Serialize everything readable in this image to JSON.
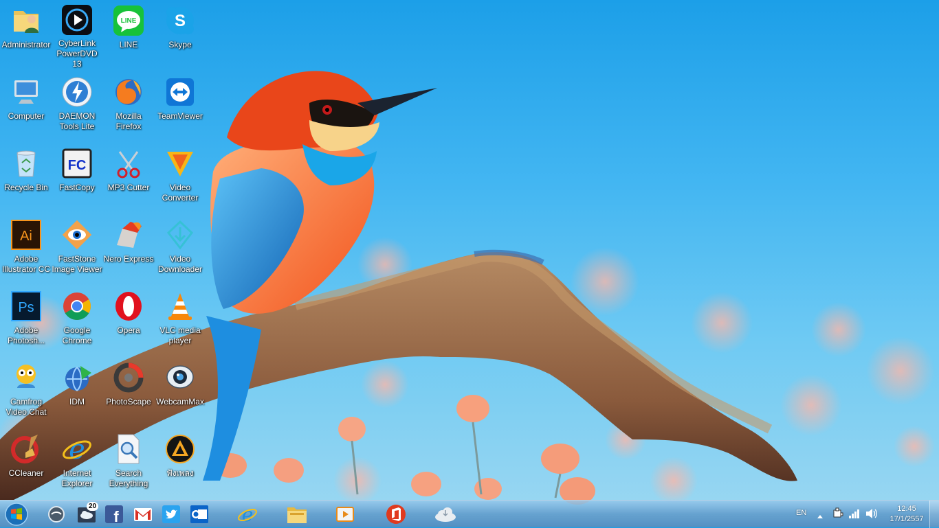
{
  "desktop": {
    "icons": [
      {
        "label": "Administrator",
        "icon": "user-folder-icon"
      },
      {
        "label": "CyberLink PowerDVD 13",
        "icon": "powerdvd-icon"
      },
      {
        "label": "LINE",
        "icon": "line-icon"
      },
      {
        "label": "Skype",
        "icon": "skype-icon"
      },
      {
        "label": "Computer",
        "icon": "computer-icon"
      },
      {
        "label": "DAEMON Tools Lite",
        "icon": "daemon-tools-icon"
      },
      {
        "label": "Mozilla Firefox",
        "icon": "firefox-icon"
      },
      {
        "label": "TeamViewer",
        "icon": "teamviewer-icon"
      },
      {
        "label": "Recycle Bin",
        "icon": "recycle-bin-icon"
      },
      {
        "label": "FastCopy",
        "icon": "fastcopy-icon"
      },
      {
        "label": "MP3 Cutter",
        "icon": "scissors-icon"
      },
      {
        "label": "Video Converter",
        "icon": "video-converter-icon"
      },
      {
        "label": "Adobe Illustrator CC",
        "icon": "illustrator-icon"
      },
      {
        "label": "FastStone Image Viewer",
        "icon": "faststone-icon"
      },
      {
        "label": "Nero Express",
        "icon": "nero-icon"
      },
      {
        "label": "Video Downloader",
        "icon": "video-downloader-icon"
      },
      {
        "label": "Adobe Photosh...",
        "icon": "photoshop-icon"
      },
      {
        "label": "Google Chrome",
        "icon": "chrome-icon"
      },
      {
        "label": "Opera",
        "icon": "opera-icon"
      },
      {
        "label": "VLC media player",
        "icon": "vlc-icon"
      },
      {
        "label": "Camfrog Video Chat",
        "icon": "camfrog-icon"
      },
      {
        "label": "IDM",
        "icon": "idm-icon"
      },
      {
        "label": "PhotoScape",
        "icon": "photoscape-icon"
      },
      {
        "label": "WebcamMax",
        "icon": "webcammax-icon"
      },
      {
        "label": "CCleaner",
        "icon": "ccleaner-icon"
      },
      {
        "label": "Internet Explorer",
        "icon": "ie-icon"
      },
      {
        "label": "Search Everything",
        "icon": "search-everything-icon"
      },
      {
        "label": "ฟังเพลง",
        "icon": "music-player-icon"
      }
    ]
  },
  "taskbar": {
    "start_icon": "windows-logo-icon",
    "weather_badge": "20",
    "pinned": [
      {
        "name": "circle-app",
        "icon": "circle-app-icon"
      },
      {
        "name": "weather",
        "icon": "weather-icon"
      },
      {
        "name": "facebook",
        "icon": "facebook-icon"
      },
      {
        "name": "gmail",
        "icon": "gmail-icon"
      },
      {
        "name": "twitter",
        "icon": "twitter-icon"
      },
      {
        "name": "outlook",
        "icon": "outlook-icon"
      },
      {
        "name": "internet-explorer",
        "icon": "ie-icon"
      },
      {
        "name": "file-explorer",
        "icon": "folder-icon"
      },
      {
        "name": "media-player",
        "icon": "media-player-icon"
      },
      {
        "name": "office",
        "icon": "office-icon"
      },
      {
        "name": "cloud-app",
        "icon": "cloud-icon"
      }
    ],
    "tray": {
      "language": "EN",
      "time": "12:45",
      "date": "17/1/2557",
      "icons": [
        "show-hidden-icon",
        "network-adapter-icon",
        "signal-icon",
        "volume-icon"
      ]
    }
  },
  "colors": {
    "sky": "#2ea8ee",
    "taskbar": "#5e9ccd",
    "bird_orange": "#f05a1e",
    "bird_blue": "#1a8ad8"
  }
}
